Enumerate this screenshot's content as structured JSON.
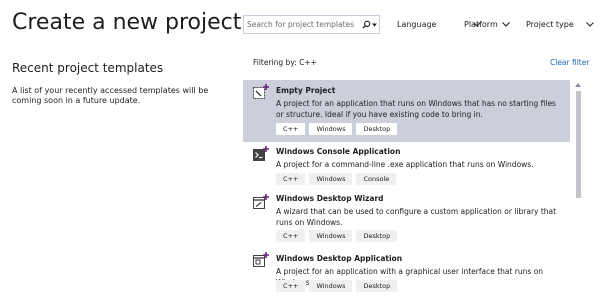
{
  "header": {
    "title": "Create a new project"
  },
  "recent": {
    "title": "Recent project templates",
    "description": "A list of your recently accessed templates will be coming soon in a future update."
  },
  "search": {
    "placeholder": "Search for project templates",
    "value": ""
  },
  "filters": {
    "language": "Language",
    "platform": "Platform",
    "project_type": "Project type"
  },
  "filter_status": {
    "text": "Filtering by: C++",
    "clear_label": "Clear filter"
  },
  "templates": [
    {
      "name": "Empty Project",
      "description": "A project for an application that runs on Windows that has no starting files or structure. Ideal if you have existing code to bring in.",
      "tags": [
        "C++",
        "Windows",
        "Desktop"
      ],
      "icon": "empty-project-icon",
      "selected": true
    },
    {
      "name": "Windows Console Application",
      "description": "A project for a command-line .exe application that runs on Windows.",
      "tags": [
        "C++",
        "Windows",
        "Console"
      ],
      "icon": "console-app-icon",
      "selected": false
    },
    {
      "name": "Windows Desktop Wizard",
      "description": "A wizard that can be used to configure a custom application or library that runs on Windows.",
      "tags": [
        "C++",
        "Windows",
        "Desktop"
      ],
      "icon": "desktop-wizard-icon",
      "selected": false
    },
    {
      "name": "Windows Desktop Application",
      "description": "A project for an application with a graphical user interface that runs on Windows.",
      "tags": [
        "C++",
        "Windows",
        "Desktop"
      ],
      "icon": "desktop-app-icon",
      "selected": false
    }
  ],
  "colors": {
    "selected_bg": "#ccceda",
    "link": "#1a66b3",
    "tag_bg": "#f0f0f2",
    "icon_plus": "#68217a",
    "scroll_thumb": "#c2c3c9"
  }
}
